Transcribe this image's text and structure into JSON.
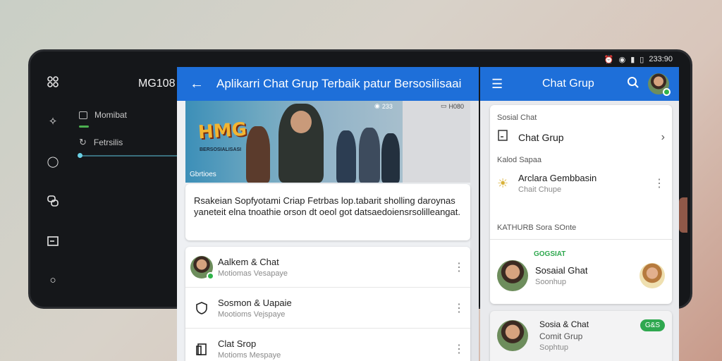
{
  "status": {
    "time": "233:90"
  },
  "rail": {
    "icons": [
      "grid-icon",
      "sparkle-icon",
      "circle-icon",
      "chat-icon",
      "window-icon",
      "circle-small-icon"
    ]
  },
  "dark_panel": {
    "title": "MG108",
    "items": [
      {
        "label": "Momibat"
      },
      {
        "label": "Fetrsilis"
      }
    ]
  },
  "middle": {
    "header": {
      "back_icon": "arrow-left-icon",
      "title": "Aplikarri Chat Grup Terbaik patur Bersosilisaai"
    },
    "video": {
      "logo_text": "HMG",
      "logo_sub": "BERSOSIALISASI",
      "caption": "Gbrtioes",
      "views": "233",
      "duration": "H080"
    },
    "description": "Rsakeian Sopfyotami Criap Fetrbas lop.tabarit sholling daroynas yaneteit elna tnoathie orson dt oeol got datsaedoiensrsolilleangat.",
    "list": [
      {
        "title": "Aalkem & Chat",
        "subtitle": "Motiomas Vesapaye"
      },
      {
        "title": "Sosmon & Uapaie",
        "subtitle": "Mootioms Vejspaye"
      },
      {
        "title": "Clat Srop",
        "subtitle": "Motioms Mespaye"
      }
    ]
  },
  "right": {
    "header": {
      "title": "Chat Grup"
    },
    "section1": "Sosial Chat",
    "row1": {
      "title": "Chat Grup"
    },
    "section2": "Kalod Sapaa",
    "row2": {
      "title": "Arclara Gembbasin",
      "subtitle": "Chait Chupe"
    },
    "section3": "KATHURB Sora SOnte",
    "feature": {
      "tag": "GOGSIAT",
      "title": "Sosaial Ghat",
      "subtitle": "Soonhup"
    },
    "card2": {
      "title": "Sosia & Chat",
      "line2": "Comit Grup",
      "line3": "Sophtup",
      "pill": "G&S"
    }
  }
}
